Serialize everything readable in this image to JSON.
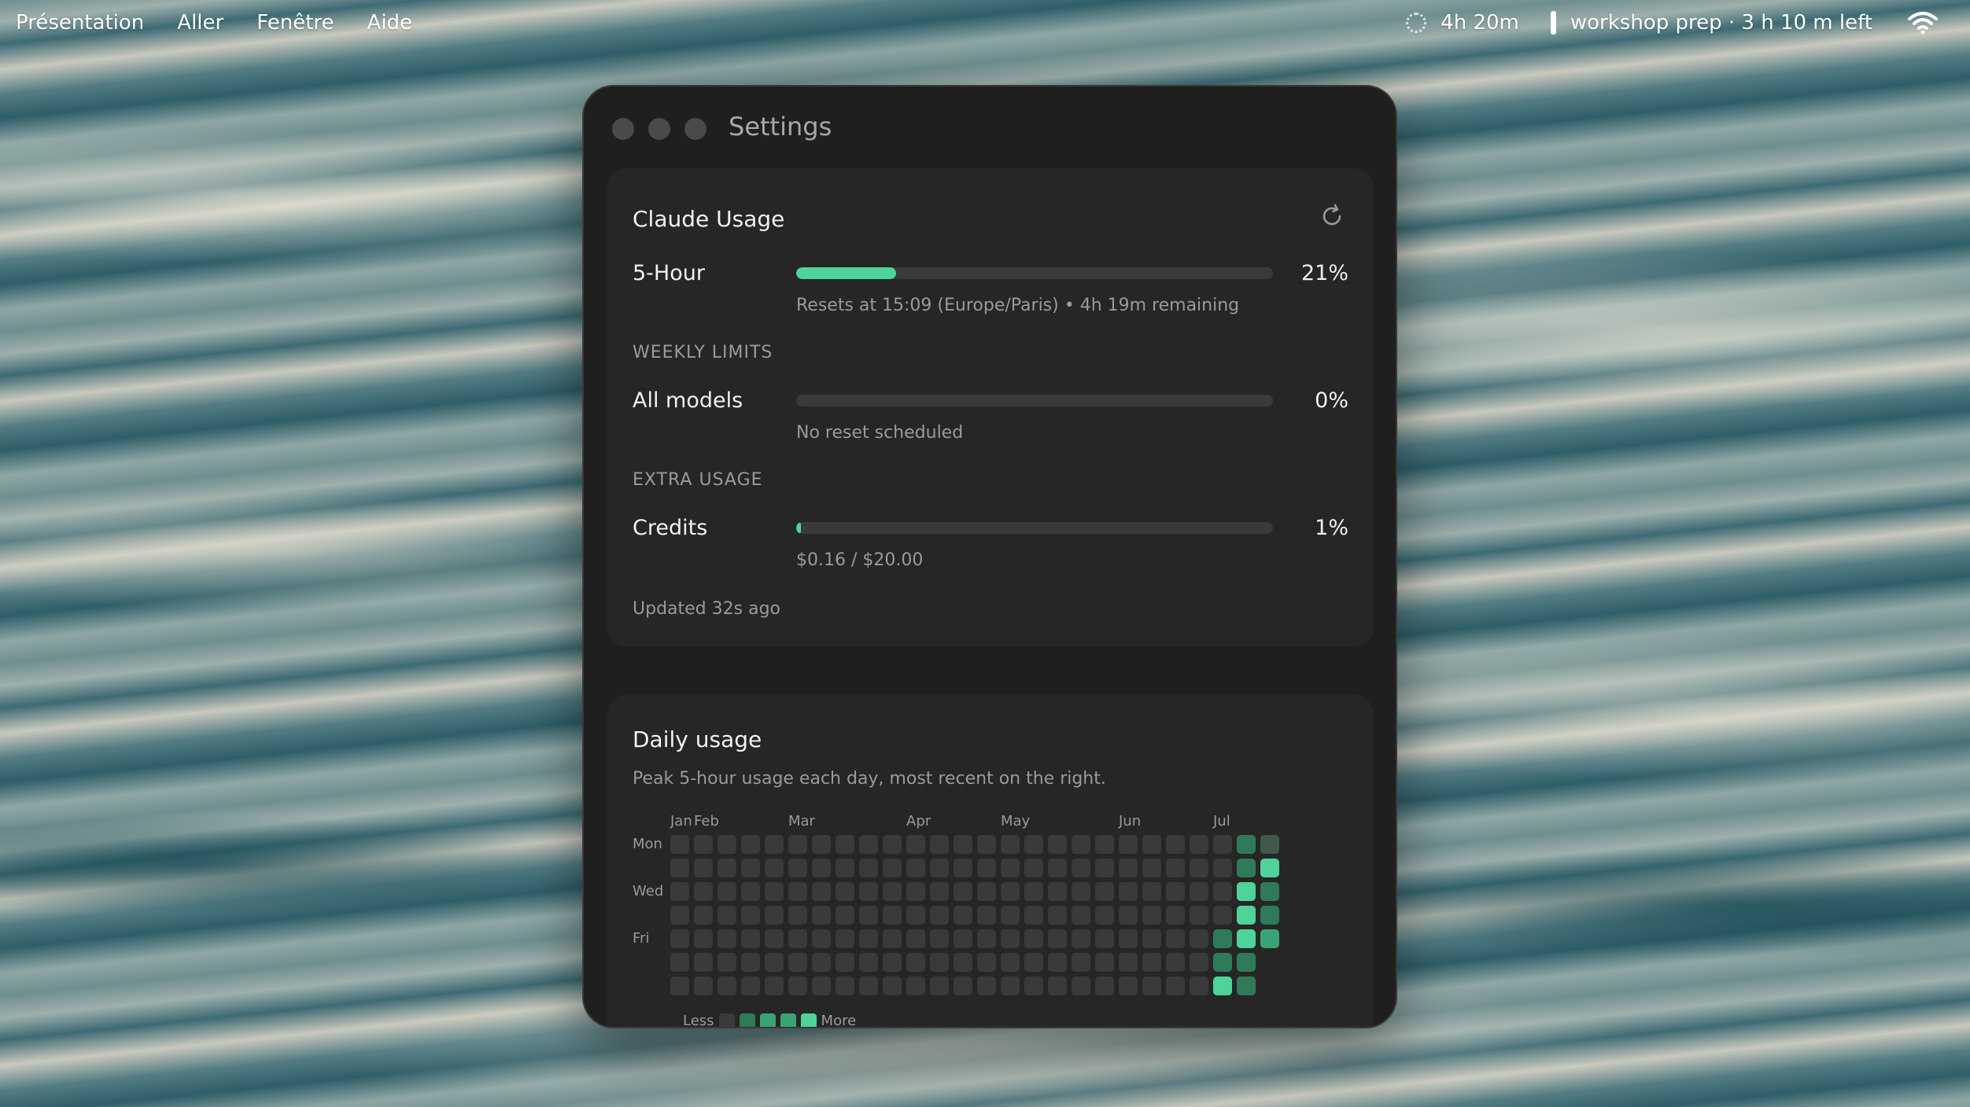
{
  "menubar": {
    "items": [
      "Présentation",
      "Aller",
      "Fenêtre",
      "Aide"
    ],
    "timer": "4h 20m",
    "status_text": "workshop prep · 3 h 10 m left"
  },
  "window": {
    "title": "Settings",
    "usage": {
      "title": "Claude Usage",
      "five_hour": {
        "label": "5-Hour",
        "percent_text": "21%",
        "fill_fraction": 0.21,
        "subtext": "Resets at 15:09 (Europe/Paris) • 4h 19m remaining"
      },
      "weekly_section": "WEEKLY LIMITS",
      "all_models": {
        "label": "All models",
        "percent_text": "0%",
        "fill_fraction": 0.0,
        "subtext": "No reset scheduled"
      },
      "extra_section": "EXTRA USAGE",
      "credits": {
        "label": "Credits",
        "percent_text": "1%",
        "fill_fraction": 0.01,
        "subtext": "$0.16 / $20.00"
      },
      "updated": "Updated 32s ago"
    },
    "daily": {
      "title": "Daily usage",
      "description": "Peak 5-hour usage each day, most recent on the right.",
      "months": [
        {
          "label": "Jan",
          "week": 0
        },
        {
          "label": "Feb",
          "week": 1
        },
        {
          "label": "Mar",
          "week": 5
        },
        {
          "label": "Apr",
          "week": 10
        },
        {
          "label": "May",
          "week": 14
        },
        {
          "label": "Jun",
          "week": 19
        },
        {
          "label": "Jul",
          "week": 23
        }
      ],
      "day_labels": [
        {
          "label": "Mon",
          "row": 0
        },
        {
          "label": "Wed",
          "row": 2
        },
        {
          "label": "Fri",
          "row": 4
        }
      ],
      "weeks": 26,
      "levels": [
        [
          0,
          0,
          0,
          0,
          0,
          0,
          0,
          0,
          0,
          0,
          0,
          0,
          0,
          0,
          0,
          0,
          0,
          0,
          0,
          0,
          0,
          0,
          0,
          0,
          2,
          1
        ],
        [
          0,
          0,
          0,
          0,
          0,
          0,
          0,
          0,
          0,
          0,
          0,
          0,
          0,
          0,
          0,
          0,
          0,
          0,
          0,
          0,
          0,
          0,
          0,
          0,
          2,
          4
        ],
        [
          0,
          0,
          0,
          0,
          0,
          0,
          0,
          0,
          0,
          0,
          0,
          0,
          0,
          0,
          0,
          0,
          0,
          0,
          0,
          0,
          0,
          0,
          0,
          0,
          4,
          2
        ],
        [
          0,
          0,
          0,
          0,
          0,
          0,
          0,
          0,
          0,
          0,
          0,
          0,
          0,
          0,
          0,
          0,
          0,
          0,
          0,
          0,
          0,
          0,
          0,
          0,
          4,
          2
        ],
        [
          0,
          0,
          0,
          0,
          0,
          0,
          0,
          0,
          0,
          0,
          0,
          0,
          0,
          0,
          0,
          0,
          0,
          0,
          0,
          0,
          0,
          0,
          0,
          2,
          4,
          3
        ],
        [
          0,
          0,
          0,
          0,
          0,
          0,
          0,
          0,
          0,
          0,
          0,
          0,
          0,
          0,
          0,
          0,
          0,
          0,
          0,
          0,
          0,
          0,
          0,
          2,
          2,
          -1
        ],
        [
          0,
          0,
          0,
          0,
          0,
          0,
          0,
          0,
          0,
          0,
          0,
          0,
          0,
          0,
          0,
          0,
          0,
          0,
          0,
          0,
          0,
          0,
          0,
          4,
          2,
          -1
        ]
      ],
      "level_colors": [
        "#3a3a3a",
        "#3f5a4c",
        "#2f7a58",
        "#3aa374",
        "#4fd39a"
      ],
      "legend": {
        "less": "Less",
        "more": "More"
      }
    }
  }
}
